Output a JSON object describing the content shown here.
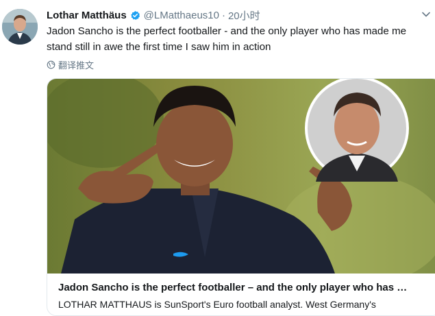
{
  "tweet": {
    "author_name": "Lothar Matthäus",
    "handle": "@LMatthaeus10",
    "separator": "·",
    "time": "20小时",
    "text": "Jadon Sancho is the perfect footballer - and the only player who has made me stand still in awe the first time I saw him in action",
    "translate_label": "翻译推文"
  },
  "card": {
    "title": "Jadon Sancho is the perfect footballer – and the only player who has …",
    "description": "LOTHAR MATTHAUS is SunSport's Euro football analyst. West Germany's"
  },
  "colors": {
    "verified": "#1da1f2",
    "secondary_text": "#657786",
    "border": "#e1e8ed"
  },
  "icons": {
    "verified": "verified-badge-icon",
    "caret": "chevron-down-icon",
    "translate": "globe-icon"
  }
}
